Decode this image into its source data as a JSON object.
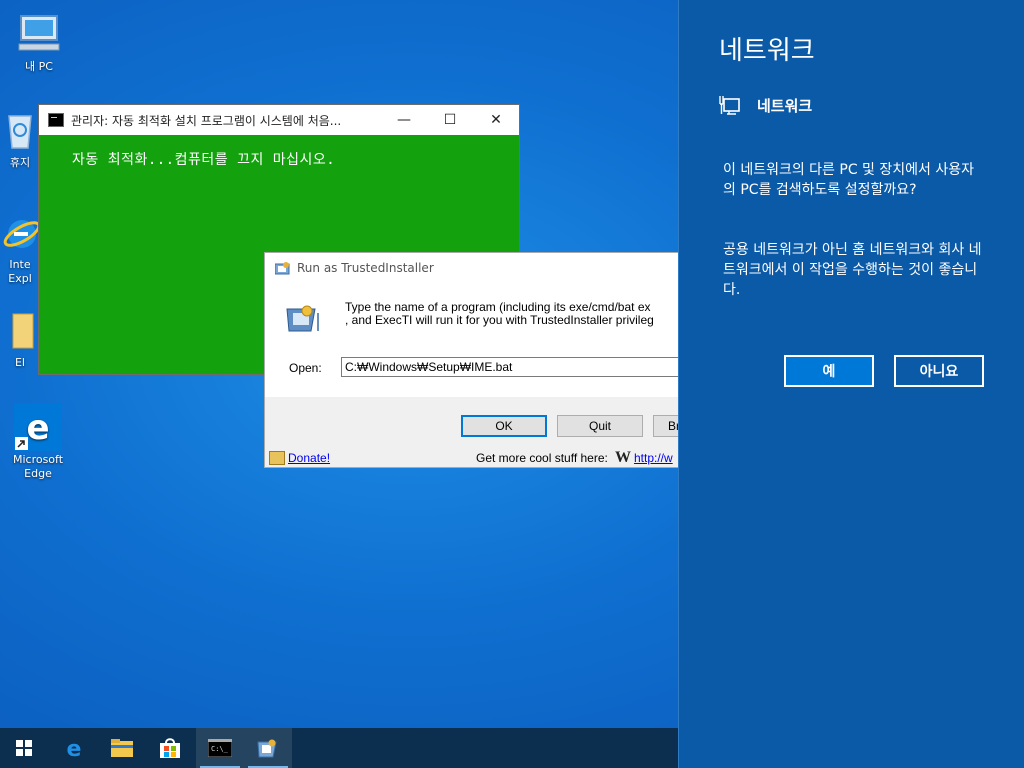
{
  "desktop": {
    "icons": [
      {
        "label": "내 PC"
      },
      {
        "label": "휴지"
      },
      {
        "label": "Inte Expl"
      },
      {
        "label": "El"
      },
      {
        "label": "Microsoft Edge"
      }
    ]
  },
  "console_window": {
    "title": "관리자:  자동 최적화 설치 프로그램이 시스템에 처음...",
    "text": "자동 최적화...컴퓨터를 끄지 마십시오.",
    "minimize": "—",
    "maximize": "☐",
    "close": "✕",
    "bg_color": "#13a10e"
  },
  "run_dialog": {
    "title": "Run as TrustedInstaller",
    "desc_line1": "Type the name of a program (including its exe/cmd/bat ex",
    "desc_line2": ", and ExecTI will run it for you with TrustedInstaller privileg",
    "open_label": "Open:",
    "open_value": "C:₩Windows₩Setup₩IME.bat",
    "ok_label": "OK",
    "quit_label": "Quit",
    "browse_label": "Br",
    "donate_label": "Donate!",
    "footer_text": "Get more cool stuff here:",
    "footer_link": "http://w"
  },
  "taskbar": {
    "items": [
      "start-icon",
      "edge-icon",
      "file-explorer-icon",
      "store-icon",
      "cmd-icon",
      "run-as-ti-icon"
    ]
  },
  "network_flyout": {
    "title": "네트워크",
    "network_name": "네트워크",
    "question": "이 네트워크의 다른 PC 및 장치에서 사용자의 PC를 검색하도록 설정할까요?",
    "hint": "공용 네트워크가 아닌 홈 네트워크와 회사 네트워크에서 이 작업을 수행하는 것이 좋습니다.",
    "yes_label": "예",
    "no_label": "아니요",
    "accent": "#0078d7",
    "bg_color": "#0b5aa7"
  }
}
